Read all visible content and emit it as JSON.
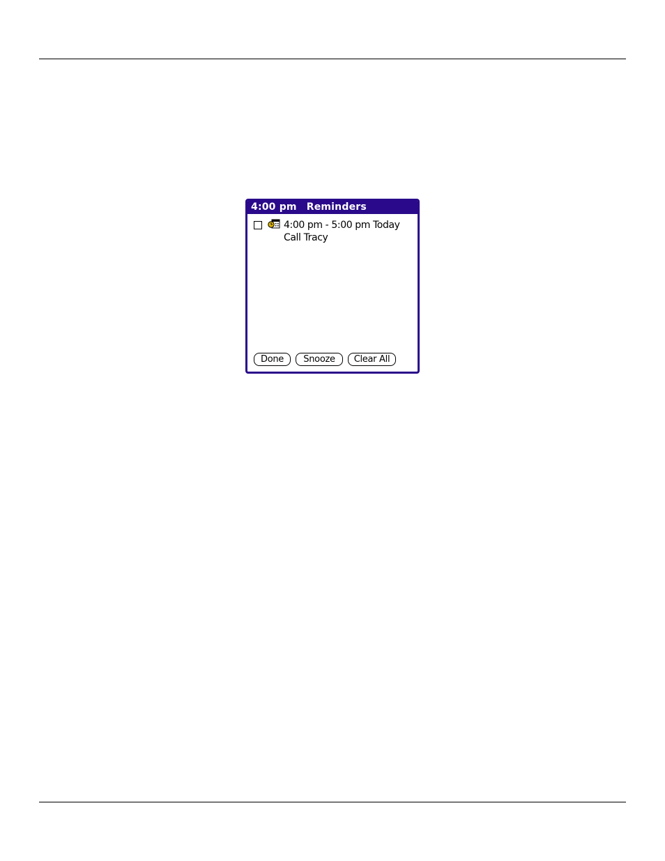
{
  "reminders_dialog": {
    "time": "4:00 pm",
    "title": "Reminders",
    "items": [
      {
        "time_range": "4:00 pm - 5:00 pm Today",
        "description": "Call Tracy",
        "checked": false,
        "icon": "calendar-alarm-icon"
      }
    ],
    "buttons": {
      "done": "Done",
      "snooze": "Snooze",
      "clear_all": "Clear All"
    },
    "colors": {
      "titlebar": "#2a0a8a",
      "icon_accent": "#d9b200"
    }
  }
}
